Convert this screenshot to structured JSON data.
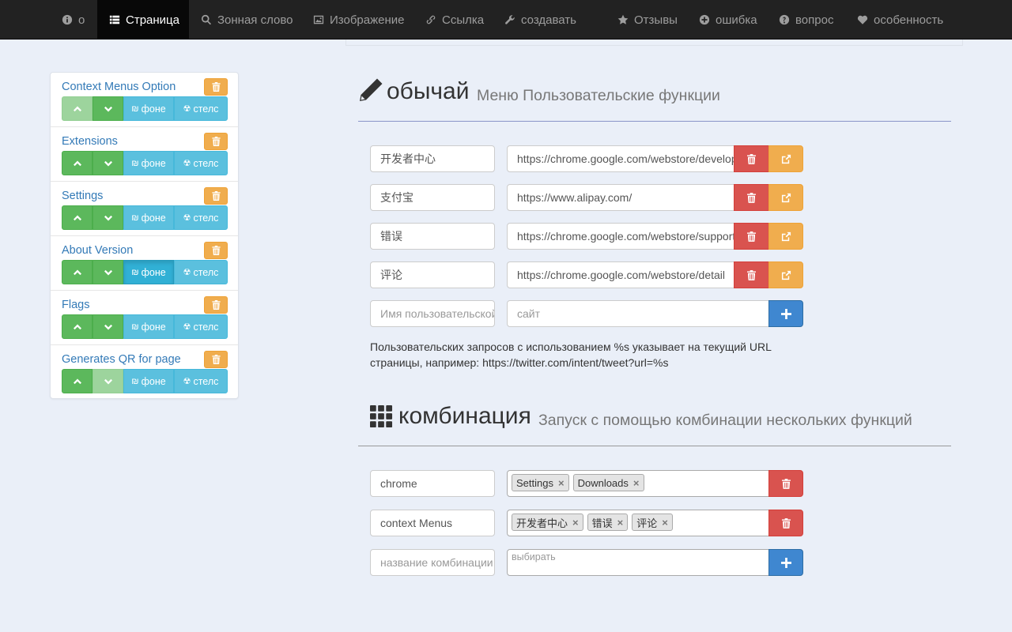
{
  "navbar": {
    "items": [
      {
        "label": "о",
        "icon": "info-circle-icon"
      },
      {
        "label": "Страница",
        "icon": "list-icon",
        "active": true
      },
      {
        "label": "Зонная слово",
        "icon": "search-icon"
      },
      {
        "label": "Изображение",
        "icon": "picture-icon"
      },
      {
        "label": "Ссылка",
        "icon": "link-icon"
      },
      {
        "label": "создавать",
        "icon": "wrench-icon"
      },
      {
        "label": "Отзывы",
        "icon": "star-icon"
      },
      {
        "label": "ошибка",
        "icon": "plus-circle-icon"
      },
      {
        "label": "вопрос",
        "icon": "question-circle-icon"
      },
      {
        "label": "особенность",
        "icon": "heart-icon"
      }
    ]
  },
  "sidebar": {
    "button_labels": {
      "background": "фоне",
      "stealth": "стелс"
    },
    "items": [
      {
        "title": "Context Menus Option",
        "up_disabled": true,
        "down_disabled": false,
        "background_active": false
      },
      {
        "title": "Extensions",
        "up_disabled": false,
        "down_disabled": false,
        "background_active": false
      },
      {
        "title": "Settings",
        "up_disabled": false,
        "down_disabled": false,
        "background_active": false
      },
      {
        "title": "About Version",
        "up_disabled": false,
        "down_disabled": false,
        "background_active": true
      },
      {
        "title": "Flags",
        "up_disabled": false,
        "down_disabled": false,
        "background_active": false
      },
      {
        "title": "Generates QR for page",
        "up_disabled": false,
        "down_disabled": true,
        "background_active": false
      }
    ]
  },
  "custom": {
    "title": "обычай",
    "subtitle": "Меню Пользовательские функции",
    "rows": [
      {
        "name": "开发者中心",
        "url": "https://chrome.google.com/webstore/developer/dashboard"
      },
      {
        "name": "支付宝",
        "url": "https://www.alipay.com/"
      },
      {
        "name": "错误",
        "url": "https://chrome.google.com/webstore/support"
      },
      {
        "name": "评论",
        "url": "https://chrome.google.com/webstore/detail"
      }
    ],
    "new_name_placeholder": "Имя пользовательской",
    "new_url_placeholder": "сайт",
    "help_line1": "Пользовательских запросов с использованием %s указывает на текущий URL",
    "help_line2": "страницы, например: https://twitter.com/intent/tweet?url=%s"
  },
  "combo": {
    "title": "комбинация",
    "subtitle": "Запуск с помощью комбинации нескольких функций",
    "rows": [
      {
        "name": "chrome",
        "tags": [
          "Settings",
          "Downloads"
        ]
      },
      {
        "name": "context Menus",
        "tags": [
          "开发者中心",
          "错误",
          "评论"
        ]
      }
    ],
    "new_name_placeholder": "название комбинации",
    "select_placeholder": "выбирать"
  },
  "colors": {
    "accent_hr": "#8a95c8",
    "navbar_bg": "#222222"
  }
}
